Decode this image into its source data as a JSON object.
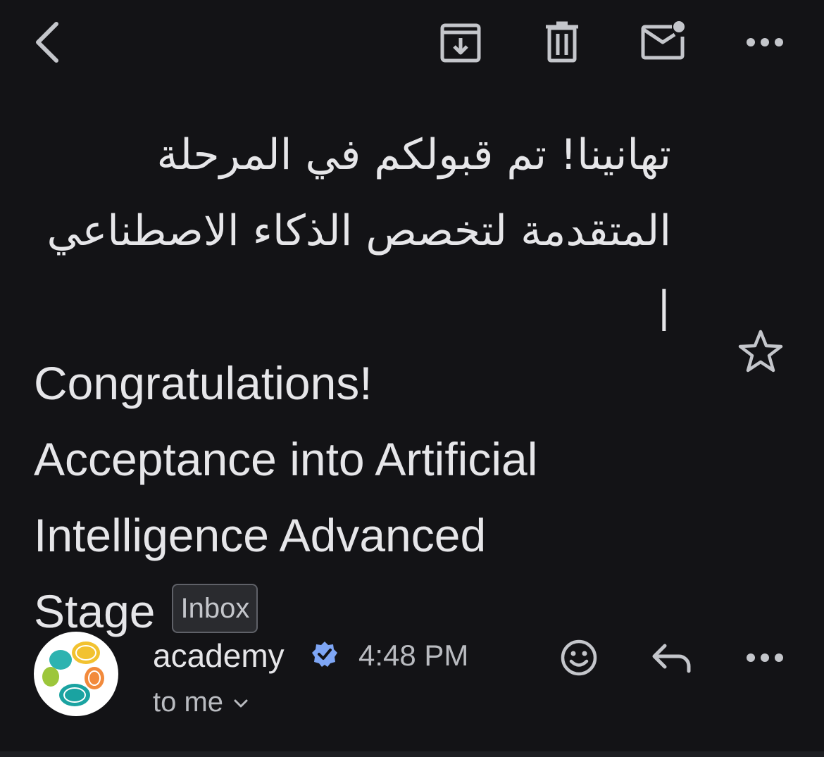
{
  "toolbar": {
    "back_icon": "chevron-left-icon",
    "archive_icon": "archive-icon",
    "delete_icon": "trash-icon",
    "mark_unread_icon": "mail-unread-icon",
    "more_icon": "more-horizontal-icon"
  },
  "subject": {
    "arabic": "تهانينا! تم قبولكم في المرحلة المتقدمة لتخصص الذكاء الاصطناعي |",
    "english_line1": "Congratulations!",
    "english_line2": "Acceptance into Artificial",
    "english_line3": "Intelligence Advanced",
    "english_line4": "Stage",
    "label": "Inbox",
    "star_icon": "star-outline-icon"
  },
  "sender": {
    "name": "academy",
    "verified_icon": "verified-badge-icon",
    "time": "4:48 PM",
    "recipient": "to me",
    "actions": {
      "emoji_icon": "emoji-reaction-icon",
      "reply_icon": "reply-icon",
      "more_icon": "more-horizontal-icon"
    }
  },
  "colors": {
    "background": "#131316",
    "text_primary": "#e6e6e9",
    "text_secondary": "#b9bbc0",
    "icon": "#c4c6cb",
    "verified": "#7ea6f5"
  }
}
